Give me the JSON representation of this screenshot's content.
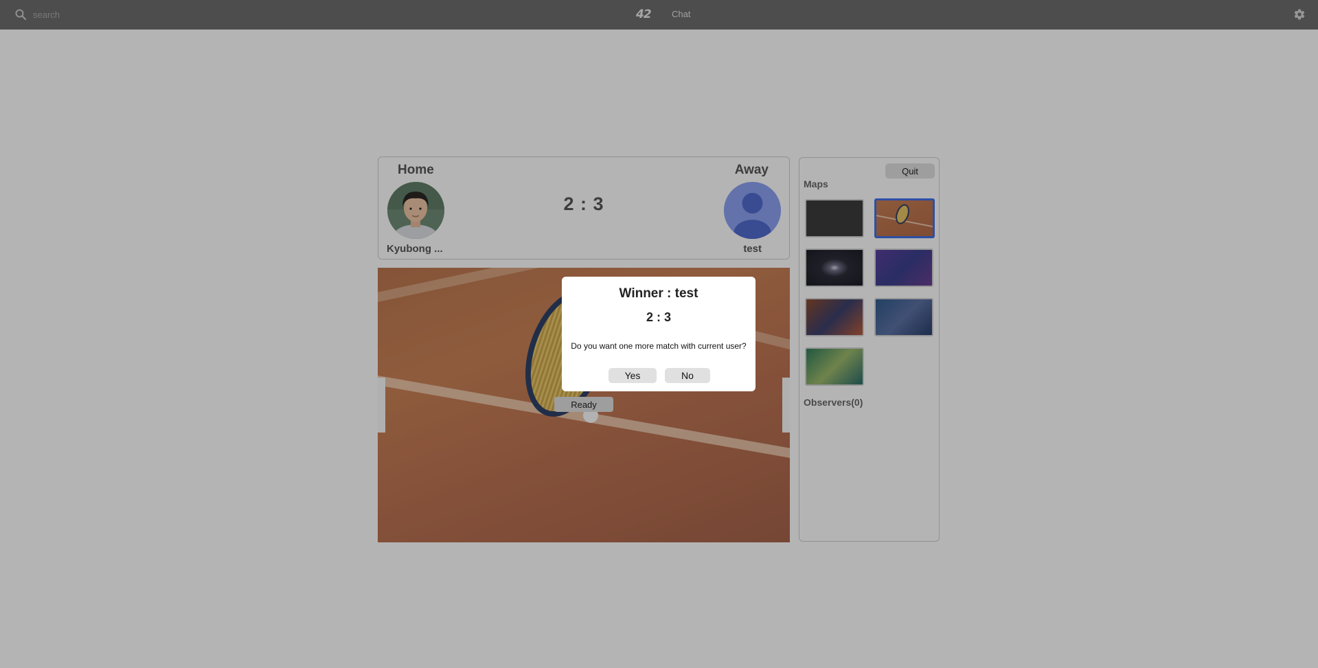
{
  "topbar": {
    "search_placeholder": "search",
    "logo_text": "42",
    "nav_chat": "Chat"
  },
  "scoreboard": {
    "home_title": "Home",
    "away_title": "Away",
    "home_player": "Kyubong ...",
    "away_player": "test",
    "score": "2 : 3"
  },
  "field": {
    "ready_label": "Ready"
  },
  "panel": {
    "quit_label": "Quit",
    "maps_heading": "Maps",
    "selected_map_index": 1,
    "observers_heading": "Observers(0)"
  },
  "modal": {
    "title": "Winner : test",
    "score": "2 : 3",
    "question": "Do you want one more match with current user?",
    "yes_label": "Yes",
    "no_label": "No"
  },
  "colors": {
    "topbar": "#6b6b6b",
    "selected_border": "#3d6ee6",
    "away_avatar": "#8a9fee"
  },
  "icons": [
    "search-icon",
    "gear-icon",
    "default-avatar-icon"
  ]
}
